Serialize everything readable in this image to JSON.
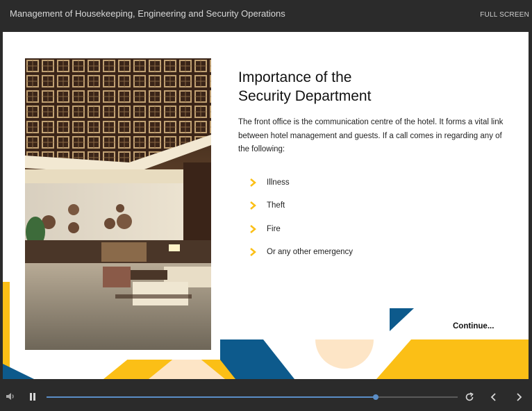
{
  "header": {
    "course_title": "Management of Housekeeping, Engineering and Security Operations",
    "fullscreen_label": "FULL SCREEN"
  },
  "slide": {
    "heading_line1": "Importance of the",
    "heading_line2": "Security Department",
    "intro_text": "The front office is the communication centre of the hotel. It forms a vital link between hotel management and guests. If a call comes in regarding any of the following:",
    "bullets": [
      "Illness",
      "Theft",
      "Fire",
      "Or any other emergency"
    ],
    "continue_label": "Continue..."
  },
  "player": {
    "progress_fraction": 0.8
  },
  "icons": {
    "bullet": "chevron-right-icon",
    "volume": "volume-icon",
    "pause": "pause-icon",
    "replay": "replay-icon",
    "previous": "chevron-left-icon",
    "next": "chevron-right-icon"
  },
  "colors": {
    "accent_yellow": "#fbbf16",
    "navy": "#0d5a8c",
    "peach": "#fde5c6",
    "progress": "#5b8ec7",
    "chrome": "#2b2b2b"
  }
}
